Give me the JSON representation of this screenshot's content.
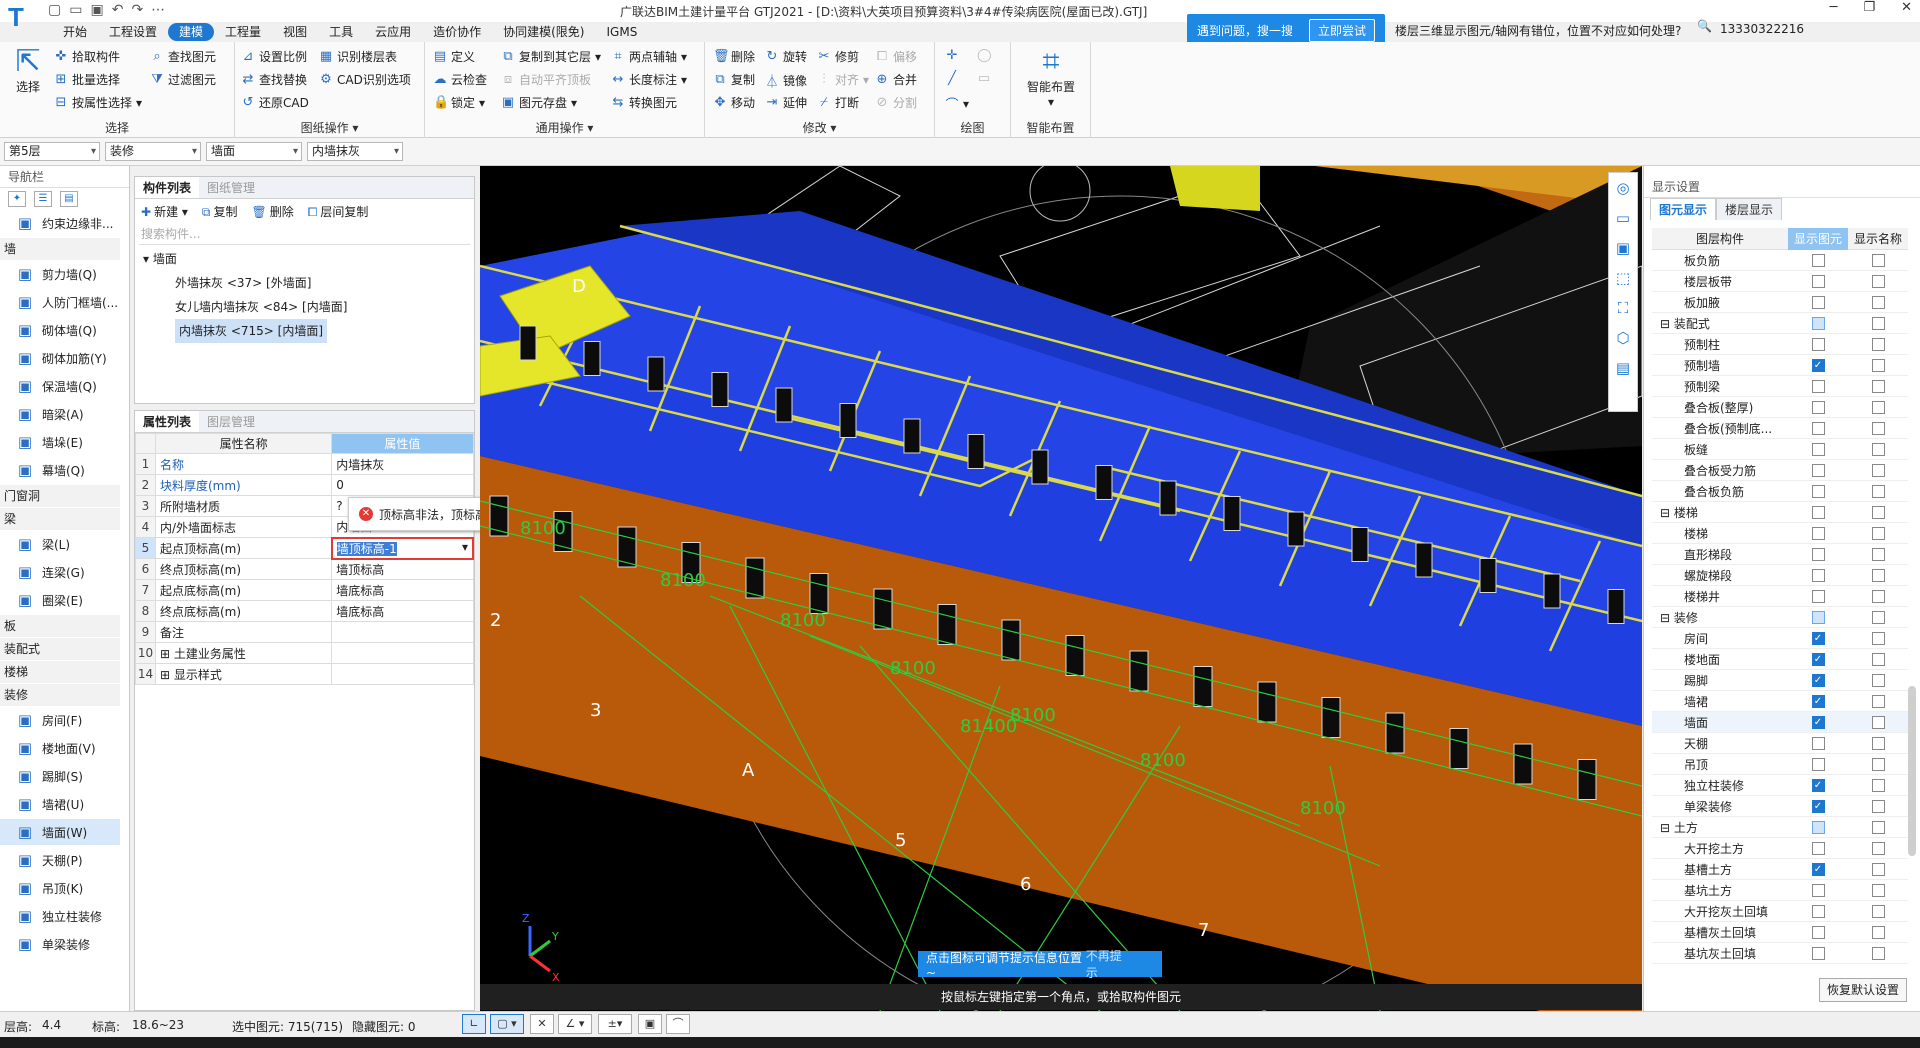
{
  "app": {
    "title": "广联达BIM土建计量平台 GTJ2021 - [D:\\资料\\大英项目预算资料\\3#4#传染病医院(屋面已改).GTJ]",
    "user": "13330322216",
    "help_text": "遇到问题，搜一搜",
    "help_button": "立即尝试",
    "help_question": "楼层三维显示图元/轴网有错位，位置不对应如何处理?"
  },
  "menu": [
    "开始",
    "工程设置",
    "建模",
    "工程量",
    "视图",
    "工具",
    "云应用",
    "造价协作",
    "协同建模(限免)",
    "IGMS"
  ],
  "menu_active": "建模",
  "ribbon": {
    "select": {
      "big": "选择",
      "items": [
        "拾取构件",
        "批量选择",
        "按属性选择",
        "查找图元",
        "过滤图元"
      ],
      "label": "选择"
    },
    "cad": {
      "items": [
        "设置比例",
        "查找替换",
        "还原CAD",
        "识别楼层表",
        "CAD识别选项"
      ],
      "label": "图纸操作"
    },
    "common": {
      "items": [
        "定义",
        "云检查",
        "锁定",
        "复制到其它层",
        "自动平齐顶板",
        "图元存盘",
        "两点辅轴",
        "长度标注",
        "转换图元"
      ],
      "label": "通用操作"
    },
    "modify": {
      "items": [
        "删除",
        "复制",
        "移动",
        "旋转",
        "镜像",
        "延伸",
        "修剪",
        "对齐",
        "打断",
        "偏移",
        "合并",
        "分割"
      ],
      "label": "修改"
    },
    "draw": {
      "label": "绘图"
    },
    "smart": {
      "big": "智能布置",
      "label": "智能布置"
    }
  },
  "filters": [
    "第5层",
    "装修",
    "墙面",
    "内墙抹灰"
  ],
  "nav": {
    "title": "导航栏",
    "items": [
      {
        "type": "item",
        "label": "约束边缘非...",
        "icon": "wall-edge-icon"
      },
      {
        "type": "cat",
        "label": "墙"
      },
      {
        "type": "item",
        "label": "剪力墙(Q)",
        "icon": "shear-wall-icon"
      },
      {
        "type": "item",
        "label": "人防门框墙(...",
        "icon": "door-frame-icon"
      },
      {
        "type": "item",
        "label": "砌体墙(Q)",
        "icon": "masonry-wall-icon"
      },
      {
        "type": "item",
        "label": "砌体加筋(Y)",
        "icon": "rebar-icon"
      },
      {
        "type": "item",
        "label": "保温墙(Q)",
        "icon": "insulation-icon"
      },
      {
        "type": "item",
        "label": "暗梁(A)",
        "icon": "hidden-beam-icon"
      },
      {
        "type": "item",
        "label": "墙垛(E)",
        "icon": "pilaster-icon"
      },
      {
        "type": "item",
        "label": "幕墙(Q)",
        "icon": "curtain-wall-icon"
      },
      {
        "type": "cat",
        "label": "门窗洞"
      },
      {
        "type": "cat",
        "label": "梁"
      },
      {
        "type": "item",
        "label": "梁(L)",
        "icon": "beam-icon"
      },
      {
        "type": "item",
        "label": "连梁(G)",
        "icon": "link-beam-icon"
      },
      {
        "type": "item",
        "label": "圈梁(E)",
        "icon": "ring-beam-icon"
      },
      {
        "type": "cat",
        "label": "板"
      },
      {
        "type": "cat",
        "label": "装配式"
      },
      {
        "type": "cat",
        "label": "楼梯"
      },
      {
        "type": "cat",
        "label": "装修"
      },
      {
        "type": "item",
        "label": "房间(F)",
        "icon": "room-icon"
      },
      {
        "type": "item",
        "label": "楼地面(V)",
        "icon": "floor-icon"
      },
      {
        "type": "item",
        "label": "踢脚(S)",
        "icon": "skirting-icon"
      },
      {
        "type": "item",
        "label": "墙裙(U)",
        "icon": "dado-icon"
      },
      {
        "type": "item",
        "label": "墙面(W)",
        "icon": "wall-face-icon",
        "selected": true
      },
      {
        "type": "item",
        "label": "天棚(P)",
        "icon": "ceiling-icon"
      },
      {
        "type": "item",
        "label": "吊顶(K)",
        "icon": "suspended-ceiling-icon"
      },
      {
        "type": "item",
        "label": "独立柱装修",
        "icon": "column-finish-icon"
      },
      {
        "type": "item",
        "label": "单梁装修",
        "icon": "beam-finish-icon"
      }
    ]
  },
  "components": {
    "tabs": [
      "构件列表",
      "图纸管理"
    ],
    "tools": [
      "新建",
      "复制",
      "删除",
      "层间复制"
    ],
    "search_placeholder": "搜索构件...",
    "root": "墙面",
    "items": [
      "外墙抹灰 <37> [外墙面]",
      "女儿墙内墙抹灰 <84> [内墙面]",
      "内墙抹灰 <715> [内墙面]"
    ]
  },
  "properties": {
    "tabs": [
      "属性列表",
      "图层管理"
    ],
    "col_name": "属性名称",
    "col_value": "属性值",
    "rows": [
      {
        "n": "1",
        "name": "名称",
        "value": "内墙抹灰",
        "blue": true
      },
      {
        "n": "2",
        "name": "块料厚度(mm)",
        "value": "0",
        "blue": true
      },
      {
        "n": "3",
        "name": "所附墙材质",
        "value": "?",
        "blue": false
      },
      {
        "n": "4",
        "name": "内/外墙面标志",
        "value": "内墙面",
        "blue": false
      },
      {
        "n": "5",
        "name": "起点顶标高(m)",
        "value": "墙顶标高-1",
        "blue": false,
        "editing": true
      },
      {
        "n": "6",
        "name": "终点顶标高(m)",
        "value": "墙顶标高",
        "blue": false
      },
      {
        "n": "7",
        "name": "起点底标高(m)",
        "value": "墙底标高",
        "blue": false
      },
      {
        "n": "8",
        "name": "终点底标高(m)",
        "value": "墙底标高",
        "blue": false
      },
      {
        "n": "9",
        "name": "备注",
        "value": "",
        "blue": false
      },
      {
        "n": "10",
        "name": "土建业务属性",
        "value": "",
        "blue": false,
        "expand": true
      },
      {
        "n": "14",
        "name": "显示样式",
        "value": "",
        "blue": false,
        "expand": true
      }
    ],
    "error": "顶标高非法，顶标高不能小于底标高"
  },
  "viewport": {
    "hint": "点击图标可调节提示信息位置~",
    "hint_dismiss": "不再提示",
    "prompt": "按鼠标左键指定第一个角点，或拾取构件图元",
    "dims": [
      "8100",
      "8100",
      "8100",
      "8100",
      "8100",
      "8100",
      "8100",
      "81400"
    ],
    "axes": [
      "D",
      "A",
      "2",
      "3",
      "5",
      "6",
      "7"
    ]
  },
  "display": {
    "title": "显示设置",
    "tabs": [
      "图元显示",
      "楼层显示"
    ],
    "col_layer": "图层构件",
    "col_show": "显示图元",
    "col_name": "显示名称",
    "rows": [
      {
        "name": "板负筋",
        "show": false,
        "indent": 2
      },
      {
        "name": "楼层板带",
        "show": false,
        "indent": 2
      },
      {
        "name": "板加腋",
        "show": false,
        "indent": 2
      },
      {
        "name": "装配式",
        "show": "part",
        "indent": 1,
        "group": true
      },
      {
        "name": "预制柱",
        "show": false,
        "indent": 2
      },
      {
        "name": "预制墙",
        "show": true,
        "indent": 2
      },
      {
        "name": "预制梁",
        "show": false,
        "indent": 2
      },
      {
        "name": "叠合板(整厚)",
        "show": false,
        "indent": 2
      },
      {
        "name": "叠合板(预制底...",
        "show": false,
        "indent": 2
      },
      {
        "name": "板缝",
        "show": false,
        "indent": 2
      },
      {
        "name": "叠合板受力筋",
        "show": false,
        "indent": 2
      },
      {
        "name": "叠合板负筋",
        "show": false,
        "indent": 2
      },
      {
        "name": "楼梯",
        "show": false,
        "indent": 1,
        "group": true
      },
      {
        "name": "楼梯",
        "show": false,
        "indent": 2
      },
      {
        "name": "直形梯段",
        "show": false,
        "indent": 2
      },
      {
        "name": "螺旋梯段",
        "show": false,
        "indent": 2
      },
      {
        "name": "楼梯井",
        "show": false,
        "indent": 2
      },
      {
        "name": "装修",
        "show": "part",
        "indent": 1,
        "group": true
      },
      {
        "name": "房间",
        "show": true,
        "indent": 2
      },
      {
        "name": "楼地面",
        "show": true,
        "indent": 2
      },
      {
        "name": "踢脚",
        "show": true,
        "indent": 2
      },
      {
        "name": "墙裙",
        "show": true,
        "indent": 2
      },
      {
        "name": "墙面",
        "show": true,
        "indent": 2
      },
      {
        "name": "天棚",
        "show": false,
        "indent": 2
      },
      {
        "name": "吊顶",
        "show": false,
        "indent": 2
      },
      {
        "name": "独立柱装修",
        "show": true,
        "indent": 2
      },
      {
        "name": "单梁装修",
        "show": true,
        "indent": 2
      },
      {
        "name": "土方",
        "show": "part",
        "indent": 1,
        "group": true
      },
      {
        "name": "大开挖土方",
        "show": false,
        "indent": 2
      },
      {
        "name": "基槽土方",
        "show": true,
        "indent": 2
      },
      {
        "name": "基坑土方",
        "show": false,
        "indent": 2
      },
      {
        "name": "大开挖灰土回填",
        "show": false,
        "indent": 2
      },
      {
        "name": "基槽灰土回填",
        "show": false,
        "indent": 2
      },
      {
        "name": "基坑灰土回填",
        "show": false,
        "indent": 2
      }
    ],
    "restore": "恢复默认设置"
  },
  "status": {
    "floor_height_label": "层高:",
    "floor_height": "4.4",
    "elev_label": "标高:",
    "elev": "18.6~23",
    "selected": "选中图元: 715(715)",
    "hidden": "隐藏图元: 0"
  },
  "colors": {
    "accent": "#1e78d2",
    "wall_blue": "#1f3fe0",
    "wall_orange": "#b85a0a",
    "grid_green": "#2ecc40",
    "outline_yellow": "#d9d94a"
  }
}
